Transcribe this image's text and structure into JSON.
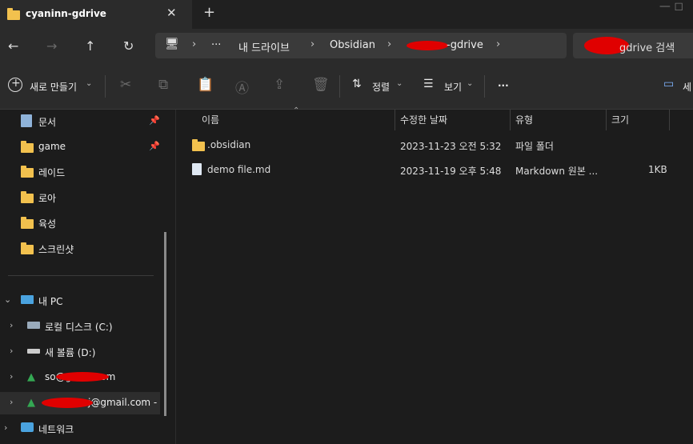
{
  "tab": {
    "title": "cyaninn-gdrive",
    "close": "✕",
    "new_tab": "+"
  },
  "window_controls": "— ◻",
  "nav": {
    "back": "←",
    "forward": "→",
    "up": "↑",
    "refresh": "↻"
  },
  "address": {
    "monitor_icon": "🖥",
    "segments": [
      "···",
      "내 드라이브",
      "Obsidian",
      "-gdrive"
    ],
    "chevron": "›"
  },
  "search": {
    "placeholder": "gdrive 검색"
  },
  "toolbar": {
    "new_label": "새로 만들기",
    "sort_label": "정렬",
    "view_label": "보기",
    "more": "···",
    "details_label": "세"
  },
  "sidebar": {
    "quick": [
      {
        "label": "문서",
        "pinned": true
      },
      {
        "label": "game",
        "pinned": true
      },
      {
        "label": "레이드",
        "pinned": false
      },
      {
        "label": "로아",
        "pinned": false
      },
      {
        "label": "육성",
        "pinned": false
      },
      {
        "label": "스크린샷",
        "pinned": false
      }
    ],
    "this_pc": "내 PC",
    "drives": [
      {
        "label": "로컬 디스크 (C:)"
      },
      {
        "label": "새 볼륨 (D:)"
      },
      {
        "label": "so@gmail.com"
      },
      {
        "label": "j@gmail.com -"
      }
    ],
    "network": "네트워크"
  },
  "columns": {
    "name": "이름",
    "modified": "수정한 날짜",
    "type": "유형",
    "size": "크기"
  },
  "files": [
    {
      "name": ".obsidian",
      "modified": "2023-11-23 오전 5:32",
      "type": "파일 폴더",
      "size": ""
    },
    {
      "name": "demo file.md",
      "modified": "2023-11-19 오후 5:48",
      "type": "Markdown 원본 ...",
      "size": "1KB"
    }
  ],
  "colors": {
    "accent": "#f2c14e",
    "background": "#1c1c1c",
    "panel": "#2b2b2b",
    "redaction": "#e00000"
  }
}
